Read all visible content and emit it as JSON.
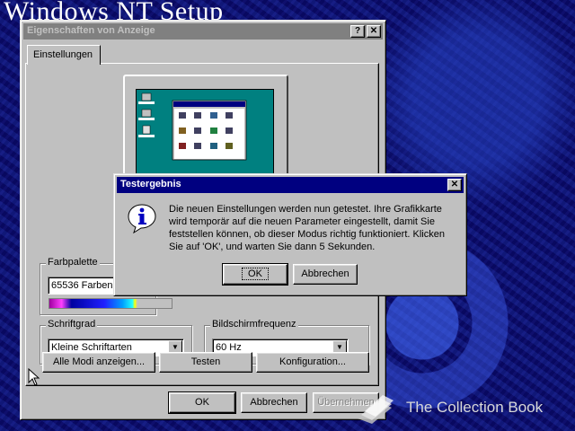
{
  "background": {
    "setup_title": "Windows NT Setup",
    "watermark_text": "The Collection Book"
  },
  "props_window": {
    "title": "Eigenschaften von Anzeige",
    "help_btn": "?",
    "close_btn": "✕",
    "tab": "Einstellungen",
    "farbpalette": {
      "label": "Farbpalette",
      "value": "65536 Farben"
    },
    "schriftgrad": {
      "label": "Schriftgrad",
      "value": "Kleine Schriftarten"
    },
    "frequenz": {
      "label": "Bildschirmfrequenz",
      "value": "60 Hz"
    },
    "buttons": {
      "alle_modi": "Alle Modi anzeigen...",
      "testen": "Testen",
      "konfiguration": "Konfiguration...",
      "ok": "OK",
      "abbrechen": "Abbrechen",
      "uebernehmen": "Übernehmen"
    },
    "preview_icons": [
      "Arbeitsplatz",
      "Netzwerkumgebung",
      "Papierkorb"
    ]
  },
  "dialog": {
    "title": "Testergebnis",
    "close_btn": "✕",
    "icon": "info-icon",
    "message": "Die neuen Einstellungen werden nun getestet. Ihre Grafikkarte wird temporär auf die neuen Parameter eingestellt, damit Sie feststellen können, ob dieser Modus richtig funktioniert. Klicken Sie auf 'OK', und warten Sie dann 5 Sekunden.",
    "ok": "OK",
    "cancel": "Abbrechen"
  },
  "colors": {
    "active_title": "#000080",
    "inactive_title": "#808080",
    "face": "#c0c0c0",
    "desktop_preview": "#008080"
  }
}
